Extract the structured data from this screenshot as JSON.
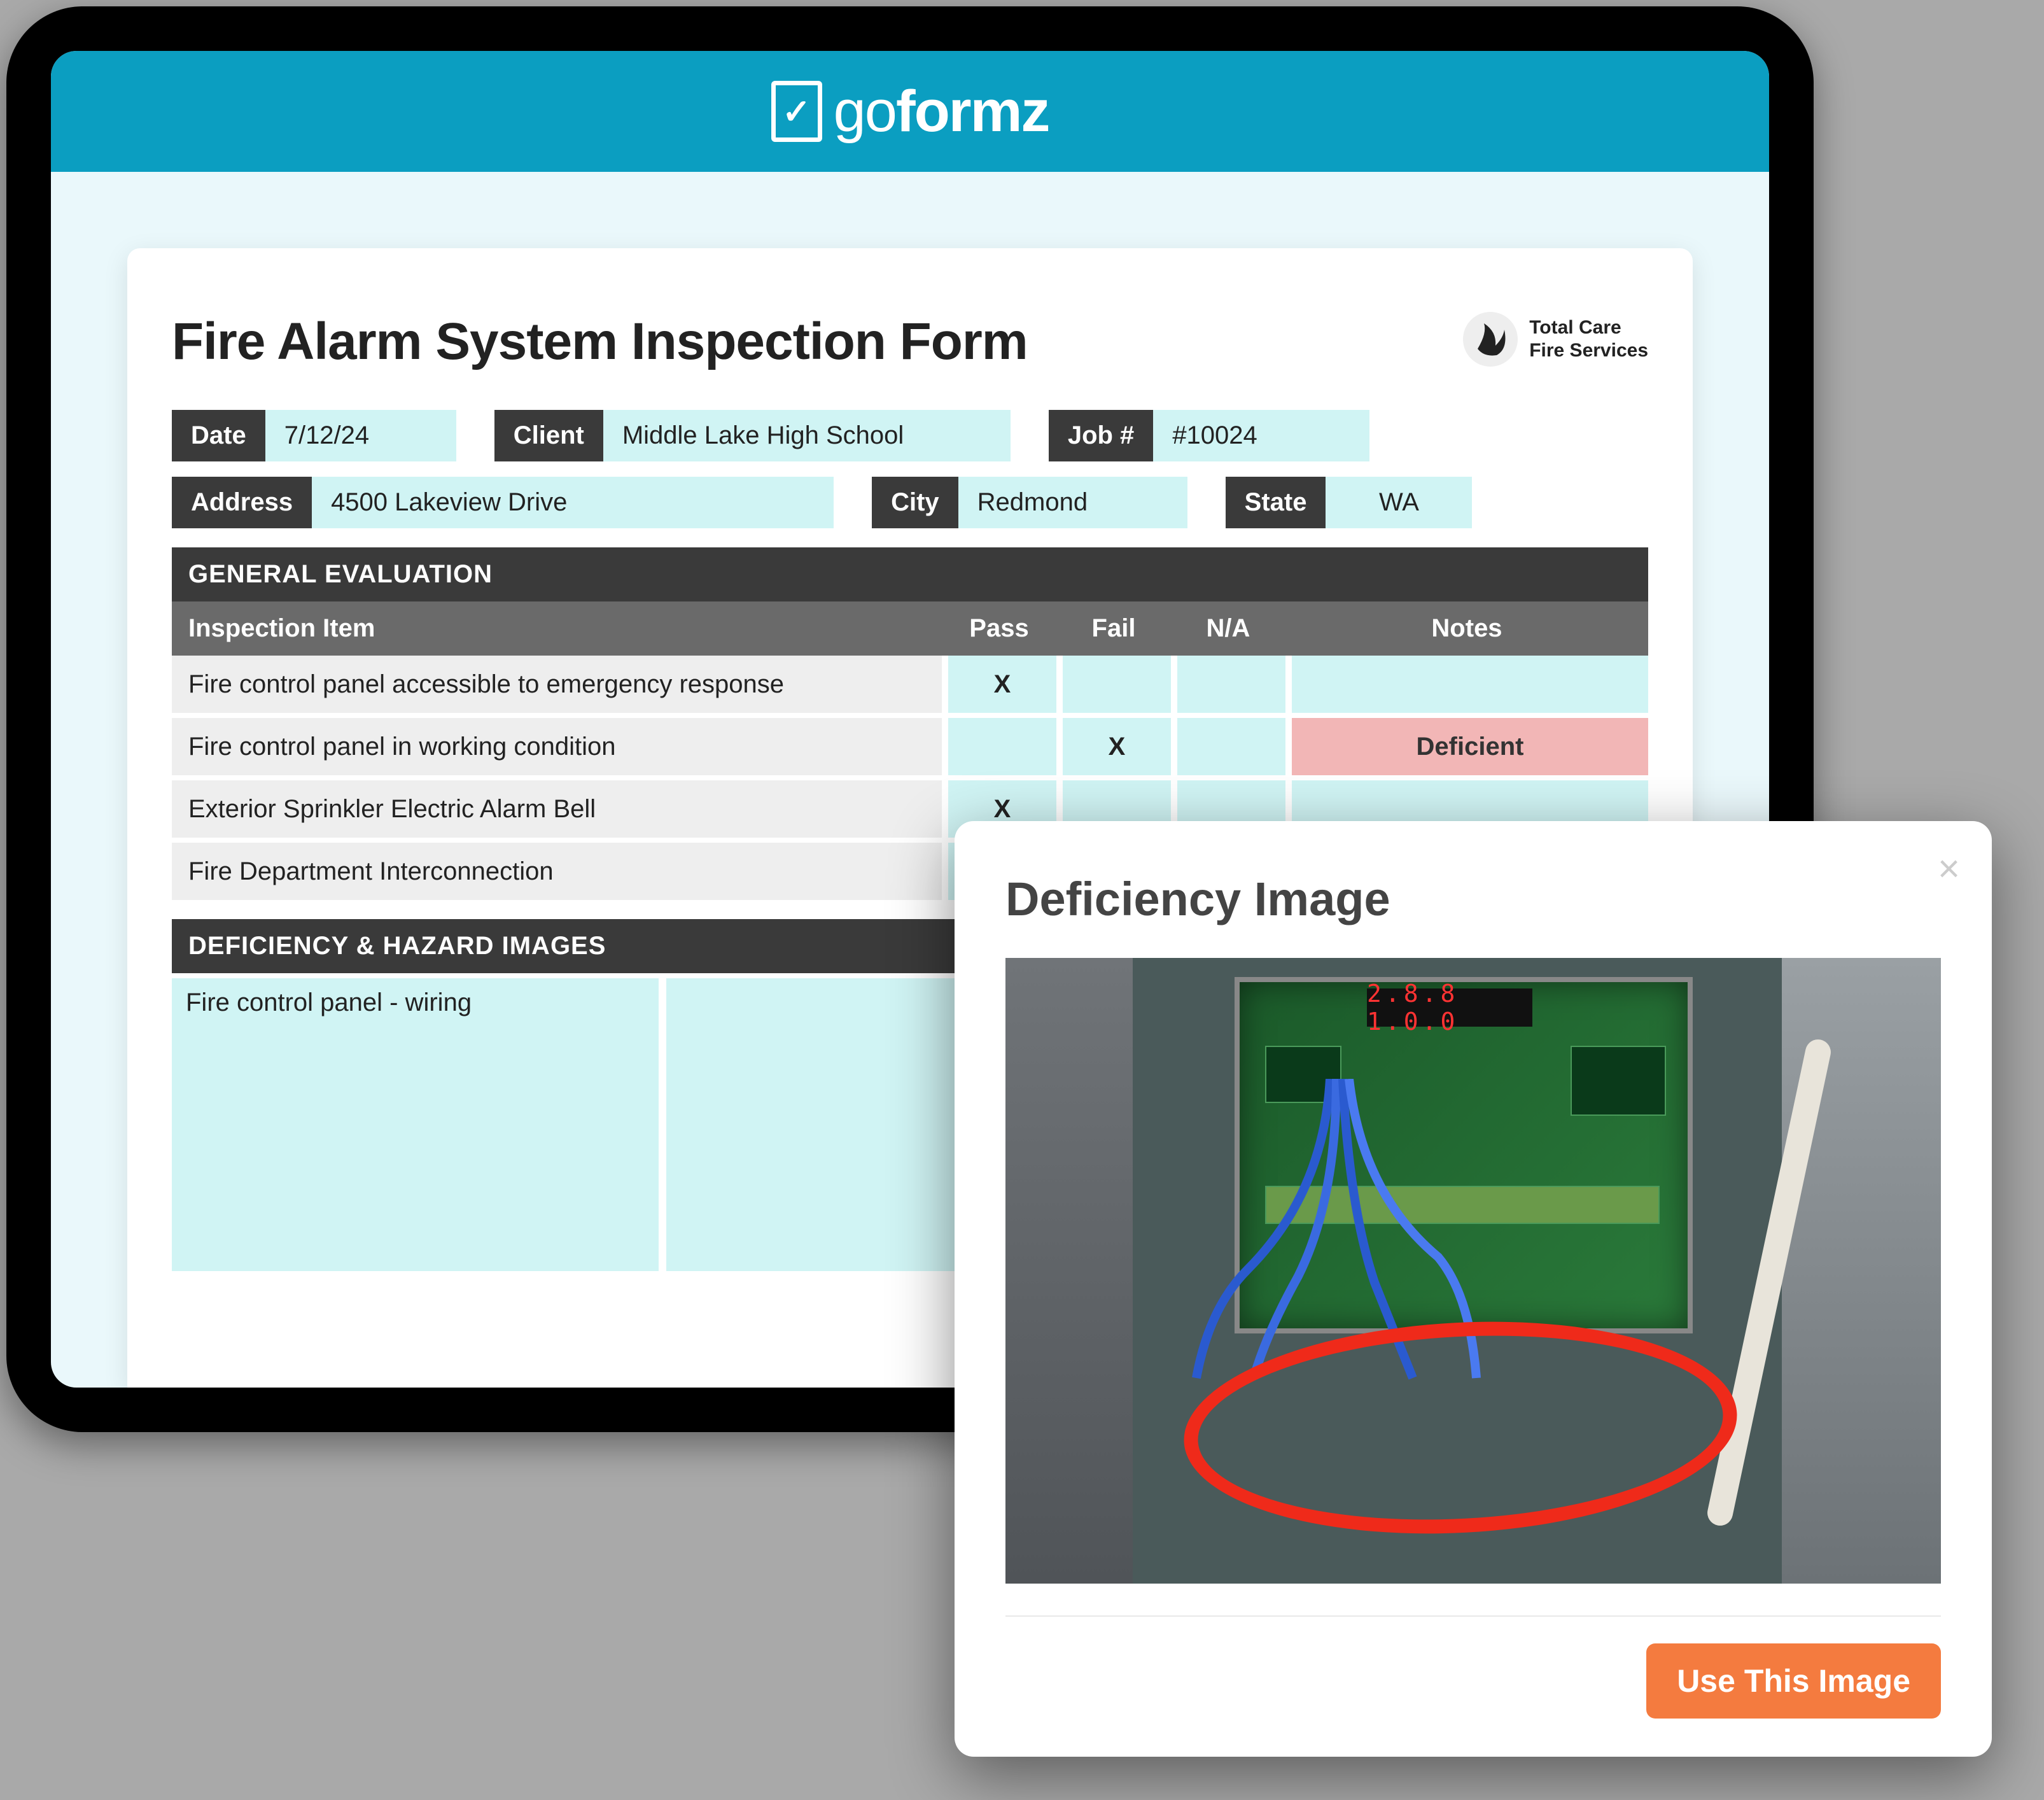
{
  "brand": {
    "prefix": "go",
    "suffix": "formz"
  },
  "company": {
    "line1": "Total Care",
    "line2": "Fire Services"
  },
  "form": {
    "title": "Fire Alarm System Inspection Form",
    "fields": {
      "date_label": "Date",
      "date": "7/12/24",
      "client_label": "Client",
      "client": "Middle Lake High School",
      "job_label": "Job #",
      "job": "#10024",
      "address_label": "Address",
      "address": "4500 Lakeview Drive",
      "city_label": "City",
      "city": "Redmond",
      "state_label": "State",
      "state": "WA"
    }
  },
  "sections": {
    "general_eval": "GENERAL EVALUATION",
    "hazard_images": "DEFICIENCY & HAZARD IMAGES"
  },
  "table": {
    "headers": {
      "item": "Inspection Item",
      "pass": "Pass",
      "fail": "Fail",
      "na": "N/A",
      "notes": "Notes"
    },
    "rows": [
      {
        "item": "Fire control panel accessible to emergency response",
        "pass": "X",
        "fail": "",
        "na": "",
        "notes": ""
      },
      {
        "item": "Fire control panel in working condition",
        "pass": "",
        "fail": "X",
        "na": "",
        "notes": "Deficient"
      },
      {
        "item": "Exterior Sprinkler Electric Alarm Bell",
        "pass": "X",
        "fail": "",
        "na": "",
        "notes": ""
      },
      {
        "item": "Fire Department Interconnection",
        "pass": "",
        "fail": "",
        "na": "",
        "notes": ""
      }
    ]
  },
  "hazard": {
    "caption": "Fire control panel - wiring"
  },
  "modal": {
    "title": "Deficiency Image",
    "button": "Use This Image",
    "led": "2.8.8 1.0.0"
  }
}
